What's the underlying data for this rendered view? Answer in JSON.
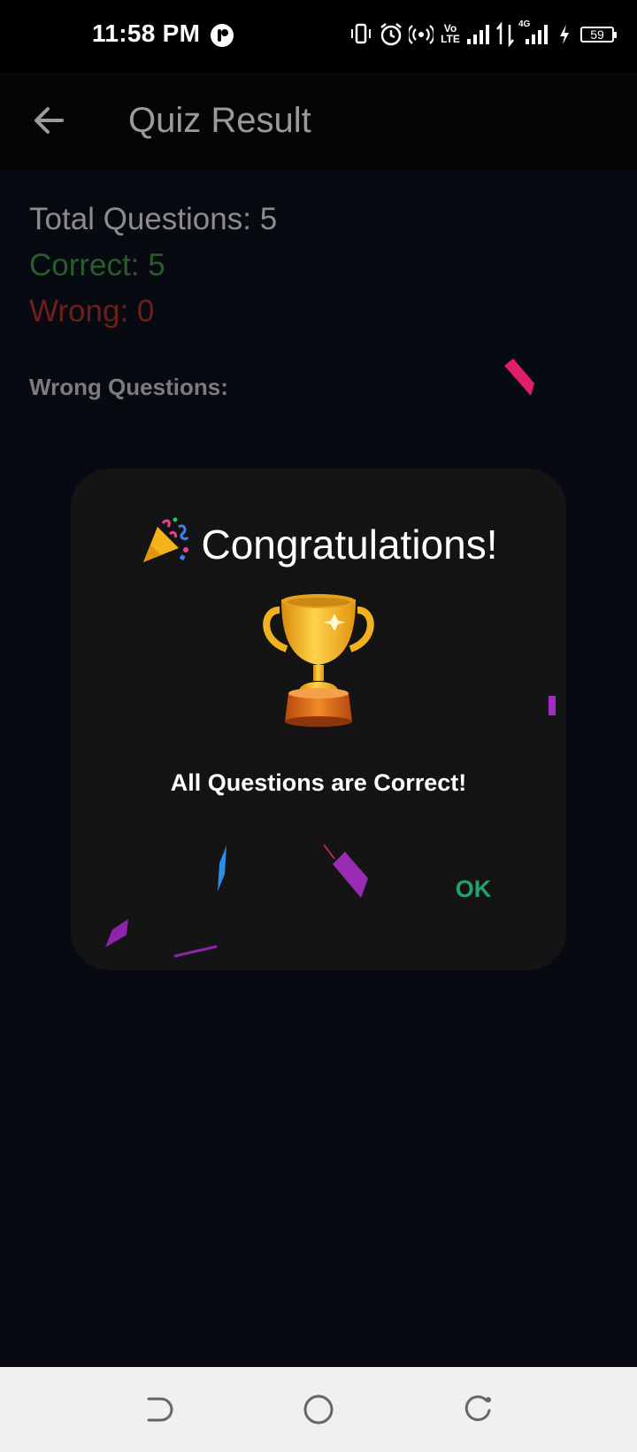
{
  "status_bar": {
    "time": "11:58 PM",
    "battery_level": "59",
    "lte_label": "Vo LTE",
    "network_label": "4G"
  },
  "app_bar": {
    "title": "Quiz Result",
    "back_icon": "arrow-left-icon"
  },
  "results": {
    "total": "Total Questions: 5",
    "correct": "Correct: 5",
    "wrong": "Wrong: 0",
    "wrong_heading": "Wrong Questions:"
  },
  "dialog": {
    "title": "Congratulations!",
    "title_icon": "party-popper-icon",
    "image_icon": "trophy-icon",
    "message": "All Questions are Correct!",
    "ok_label": "OK"
  },
  "nav_bar": {
    "icons": [
      "back-icon",
      "home-icon",
      "recents-icon"
    ]
  },
  "colors": {
    "background": "#080a12",
    "correct": "#2a5b2c",
    "wrong": "#6e1e1b",
    "accent": "#22a36b",
    "dialog": "#141414"
  }
}
